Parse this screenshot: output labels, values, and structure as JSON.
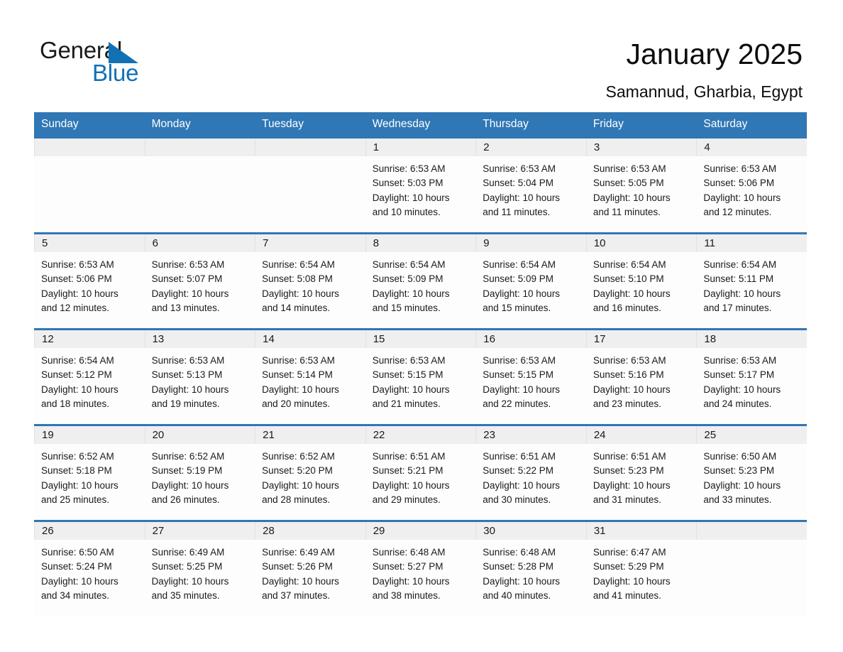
{
  "brand": {
    "word1": "General",
    "word2": "Blue",
    "triangle_color": "#1271b5",
    "word2_color": "#1271b5"
  },
  "header": {
    "title": "January 2025",
    "subtitle": "Samannud, Gharbia, Egypt"
  },
  "calendar": {
    "header_bg": "#3077b5",
    "row_rule_color": "#3077b5",
    "daynum_bg": "#efefef",
    "weekday_headers": [
      "Sunday",
      "Monday",
      "Tuesday",
      "Wednesday",
      "Thursday",
      "Friday",
      "Saturday"
    ],
    "weeks": [
      [
        {
          "day": "",
          "sunrise": "",
          "sunset": "",
          "daylight_1": "",
          "daylight_2": ""
        },
        {
          "day": "",
          "sunrise": "",
          "sunset": "",
          "daylight_1": "",
          "daylight_2": ""
        },
        {
          "day": "",
          "sunrise": "",
          "sunset": "",
          "daylight_1": "",
          "daylight_2": ""
        },
        {
          "day": "1",
          "sunrise": "Sunrise: 6:53 AM",
          "sunset": "Sunset: 5:03 PM",
          "daylight_1": "Daylight: 10 hours",
          "daylight_2": "and 10 minutes."
        },
        {
          "day": "2",
          "sunrise": "Sunrise: 6:53 AM",
          "sunset": "Sunset: 5:04 PM",
          "daylight_1": "Daylight: 10 hours",
          "daylight_2": "and 11 minutes."
        },
        {
          "day": "3",
          "sunrise": "Sunrise: 6:53 AM",
          "sunset": "Sunset: 5:05 PM",
          "daylight_1": "Daylight: 10 hours",
          "daylight_2": "and 11 minutes."
        },
        {
          "day": "4",
          "sunrise": "Sunrise: 6:53 AM",
          "sunset": "Sunset: 5:06 PM",
          "daylight_1": "Daylight: 10 hours",
          "daylight_2": "and 12 minutes."
        }
      ],
      [
        {
          "day": "5",
          "sunrise": "Sunrise: 6:53 AM",
          "sunset": "Sunset: 5:06 PM",
          "daylight_1": "Daylight: 10 hours",
          "daylight_2": "and 12 minutes."
        },
        {
          "day": "6",
          "sunrise": "Sunrise: 6:53 AM",
          "sunset": "Sunset: 5:07 PM",
          "daylight_1": "Daylight: 10 hours",
          "daylight_2": "and 13 minutes."
        },
        {
          "day": "7",
          "sunrise": "Sunrise: 6:54 AM",
          "sunset": "Sunset: 5:08 PM",
          "daylight_1": "Daylight: 10 hours",
          "daylight_2": "and 14 minutes."
        },
        {
          "day": "8",
          "sunrise": "Sunrise: 6:54 AM",
          "sunset": "Sunset: 5:09 PM",
          "daylight_1": "Daylight: 10 hours",
          "daylight_2": "and 15 minutes."
        },
        {
          "day": "9",
          "sunrise": "Sunrise: 6:54 AM",
          "sunset": "Sunset: 5:09 PM",
          "daylight_1": "Daylight: 10 hours",
          "daylight_2": "and 15 minutes."
        },
        {
          "day": "10",
          "sunrise": "Sunrise: 6:54 AM",
          "sunset": "Sunset: 5:10 PM",
          "daylight_1": "Daylight: 10 hours",
          "daylight_2": "and 16 minutes."
        },
        {
          "day": "11",
          "sunrise": "Sunrise: 6:54 AM",
          "sunset": "Sunset: 5:11 PM",
          "daylight_1": "Daylight: 10 hours",
          "daylight_2": "and 17 minutes."
        }
      ],
      [
        {
          "day": "12",
          "sunrise": "Sunrise: 6:54 AM",
          "sunset": "Sunset: 5:12 PM",
          "daylight_1": "Daylight: 10 hours",
          "daylight_2": "and 18 minutes."
        },
        {
          "day": "13",
          "sunrise": "Sunrise: 6:53 AM",
          "sunset": "Sunset: 5:13 PM",
          "daylight_1": "Daylight: 10 hours",
          "daylight_2": "and 19 minutes."
        },
        {
          "day": "14",
          "sunrise": "Sunrise: 6:53 AM",
          "sunset": "Sunset: 5:14 PM",
          "daylight_1": "Daylight: 10 hours",
          "daylight_2": "and 20 minutes."
        },
        {
          "day": "15",
          "sunrise": "Sunrise: 6:53 AM",
          "sunset": "Sunset: 5:15 PM",
          "daylight_1": "Daylight: 10 hours",
          "daylight_2": "and 21 minutes."
        },
        {
          "day": "16",
          "sunrise": "Sunrise: 6:53 AM",
          "sunset": "Sunset: 5:15 PM",
          "daylight_1": "Daylight: 10 hours",
          "daylight_2": "and 22 minutes."
        },
        {
          "day": "17",
          "sunrise": "Sunrise: 6:53 AM",
          "sunset": "Sunset: 5:16 PM",
          "daylight_1": "Daylight: 10 hours",
          "daylight_2": "and 23 minutes."
        },
        {
          "day": "18",
          "sunrise": "Sunrise: 6:53 AM",
          "sunset": "Sunset: 5:17 PM",
          "daylight_1": "Daylight: 10 hours",
          "daylight_2": "and 24 minutes."
        }
      ],
      [
        {
          "day": "19",
          "sunrise": "Sunrise: 6:52 AM",
          "sunset": "Sunset: 5:18 PM",
          "daylight_1": "Daylight: 10 hours",
          "daylight_2": "and 25 minutes."
        },
        {
          "day": "20",
          "sunrise": "Sunrise: 6:52 AM",
          "sunset": "Sunset: 5:19 PM",
          "daylight_1": "Daylight: 10 hours",
          "daylight_2": "and 26 minutes."
        },
        {
          "day": "21",
          "sunrise": "Sunrise: 6:52 AM",
          "sunset": "Sunset: 5:20 PM",
          "daylight_1": "Daylight: 10 hours",
          "daylight_2": "and 28 minutes."
        },
        {
          "day": "22",
          "sunrise": "Sunrise: 6:51 AM",
          "sunset": "Sunset: 5:21 PM",
          "daylight_1": "Daylight: 10 hours",
          "daylight_2": "and 29 minutes."
        },
        {
          "day": "23",
          "sunrise": "Sunrise: 6:51 AM",
          "sunset": "Sunset: 5:22 PM",
          "daylight_1": "Daylight: 10 hours",
          "daylight_2": "and 30 minutes."
        },
        {
          "day": "24",
          "sunrise": "Sunrise: 6:51 AM",
          "sunset": "Sunset: 5:23 PM",
          "daylight_1": "Daylight: 10 hours",
          "daylight_2": "and 31 minutes."
        },
        {
          "day": "25",
          "sunrise": "Sunrise: 6:50 AM",
          "sunset": "Sunset: 5:23 PM",
          "daylight_1": "Daylight: 10 hours",
          "daylight_2": "and 33 minutes."
        }
      ],
      [
        {
          "day": "26",
          "sunrise": "Sunrise: 6:50 AM",
          "sunset": "Sunset: 5:24 PM",
          "daylight_1": "Daylight: 10 hours",
          "daylight_2": "and 34 minutes."
        },
        {
          "day": "27",
          "sunrise": "Sunrise: 6:49 AM",
          "sunset": "Sunset: 5:25 PM",
          "daylight_1": "Daylight: 10 hours",
          "daylight_2": "and 35 minutes."
        },
        {
          "day": "28",
          "sunrise": "Sunrise: 6:49 AM",
          "sunset": "Sunset: 5:26 PM",
          "daylight_1": "Daylight: 10 hours",
          "daylight_2": "and 37 minutes."
        },
        {
          "day": "29",
          "sunrise": "Sunrise: 6:48 AM",
          "sunset": "Sunset: 5:27 PM",
          "daylight_1": "Daylight: 10 hours",
          "daylight_2": "and 38 minutes."
        },
        {
          "day": "30",
          "sunrise": "Sunrise: 6:48 AM",
          "sunset": "Sunset: 5:28 PM",
          "daylight_1": "Daylight: 10 hours",
          "daylight_2": "and 40 minutes."
        },
        {
          "day": "31",
          "sunrise": "Sunrise: 6:47 AM",
          "sunset": "Sunset: 5:29 PM",
          "daylight_1": "Daylight: 10 hours",
          "daylight_2": "and 41 minutes."
        },
        {
          "day": "",
          "sunrise": "",
          "sunset": "",
          "daylight_1": "",
          "daylight_2": ""
        }
      ]
    ]
  }
}
